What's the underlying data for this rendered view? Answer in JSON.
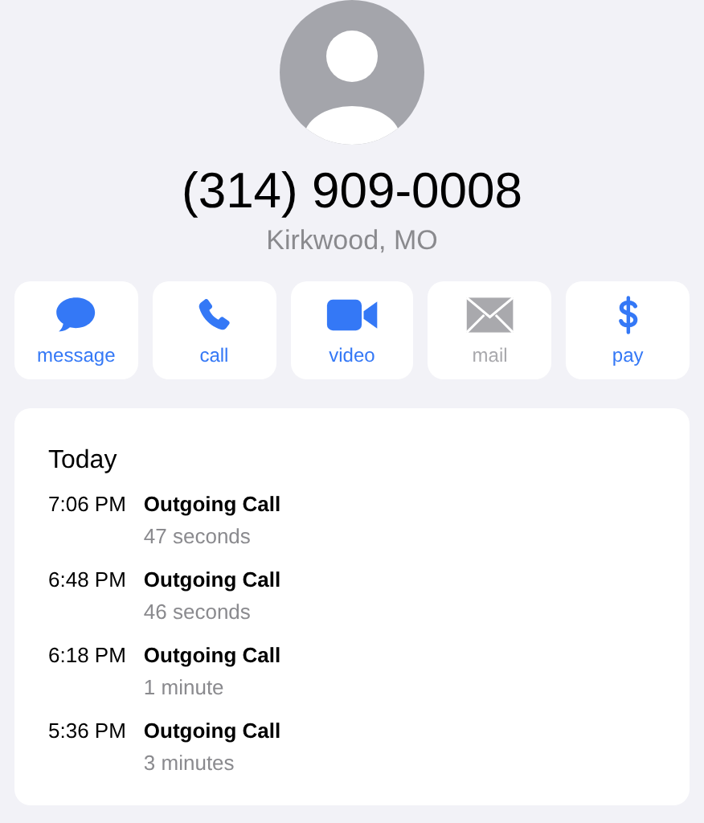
{
  "contact": {
    "phone": "(314) 909-0008",
    "location": "Kirkwood, MO"
  },
  "actions": [
    {
      "kind": "message",
      "label": "message",
      "disabled": false
    },
    {
      "kind": "call",
      "label": "call",
      "disabled": false
    },
    {
      "kind": "video",
      "label": "video",
      "disabled": false
    },
    {
      "kind": "mail",
      "label": "mail",
      "disabled": true
    },
    {
      "kind": "pay",
      "label": "pay",
      "disabled": false
    }
  ],
  "recents": {
    "heading": "Today",
    "calls": [
      {
        "time": "7:06 PM",
        "type": "Outgoing Call",
        "duration": "47 seconds"
      },
      {
        "time": "6:48 PM",
        "type": "Outgoing Call",
        "duration": "46 seconds"
      },
      {
        "time": "6:18 PM",
        "type": "Outgoing Call",
        "duration": "1 minute"
      },
      {
        "time": "5:36 PM",
        "type": "Outgoing Call",
        "duration": "3 minutes"
      }
    ]
  }
}
